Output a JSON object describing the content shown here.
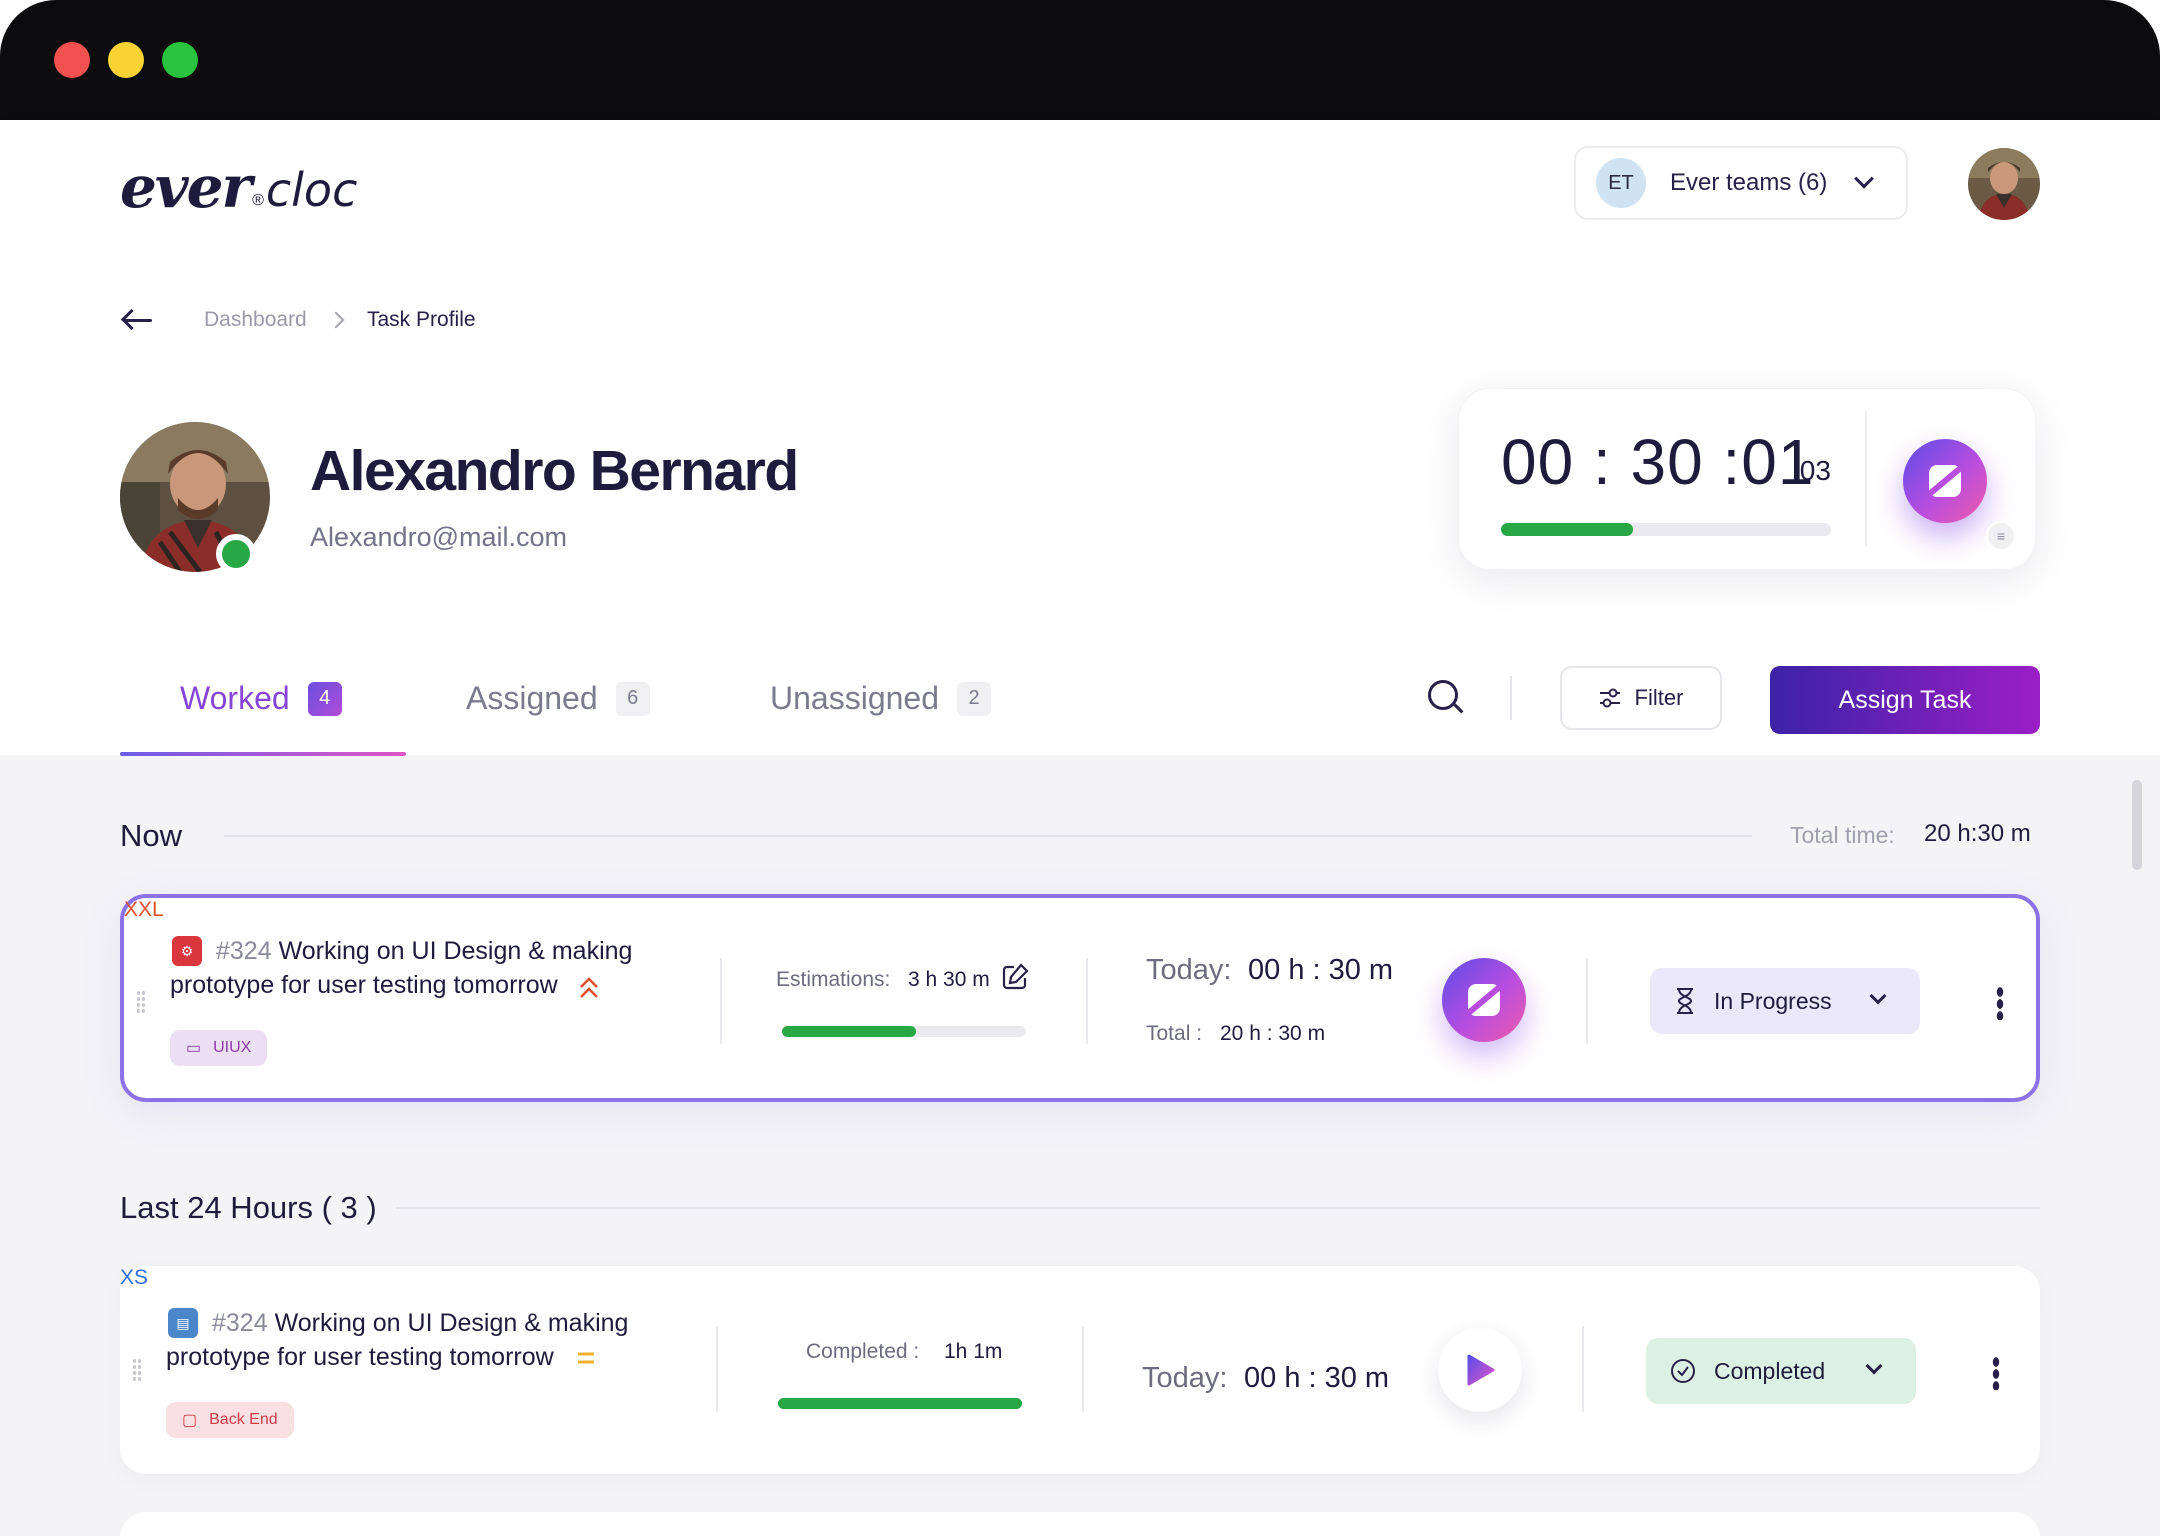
{
  "header": {
    "logo": {
      "ever": "ever",
      "reg": "®",
      "cloc": "cloc"
    },
    "team": {
      "badge": "ET",
      "name": "Ever teams (6)"
    }
  },
  "breadcrumb": {
    "parent": "Dashboard",
    "current": "Task Profile"
  },
  "profile": {
    "name": "Alexandro Bernard",
    "email": "Alexandro@mail.com",
    "status": "online"
  },
  "timer": {
    "time": "00 : 30 :01",
    "ms": ":03",
    "progress": 0.4
  },
  "tabs": [
    {
      "label": "Worked",
      "count": "4",
      "active": true
    },
    {
      "label": "Assigned",
      "count": "6",
      "active": false
    },
    {
      "label": "Unassigned",
      "count": "2",
      "active": false
    }
  ],
  "toolbar": {
    "filter_label": "Filter",
    "assign_label": "Assign Task"
  },
  "sections": {
    "now": {
      "title": "Now",
      "total_label": "Total time:",
      "total_value": "20 h:30 m"
    },
    "last24": {
      "title": "Last 24 Hours ( 3 )"
    }
  },
  "tasks": [
    {
      "number": "#324",
      "title_line1": "Working on UI Design & making",
      "title_line2": "prototype for user testing tomorrow",
      "size": "XXL",
      "size_color": "#e0532f",
      "label": "UIUX",
      "est_label": "Estimations:",
      "est_value": "3 h 30 m",
      "progress": 0.55,
      "today_label": "Today:",
      "today_value": "00 h : 30 m",
      "total_label": "Total :",
      "total_value": "20 h : 30 m",
      "status": "In Progress"
    },
    {
      "number": "#324",
      "title_line1": "Working on UI Design & making",
      "title_line2": "prototype for user testing tomorrow",
      "size": "XS",
      "size_color": "#2f6fe0",
      "label": "Back End",
      "est_label": "Completed :",
      "est_value": "1h 1m",
      "progress": 1.0,
      "today_label": "Today:",
      "today_value": "00 h : 30 m",
      "status": "Completed"
    }
  ],
  "colors": {
    "accent": "#8645d4",
    "success": "#28a745",
    "brand_dark": "#1e1b3d"
  }
}
